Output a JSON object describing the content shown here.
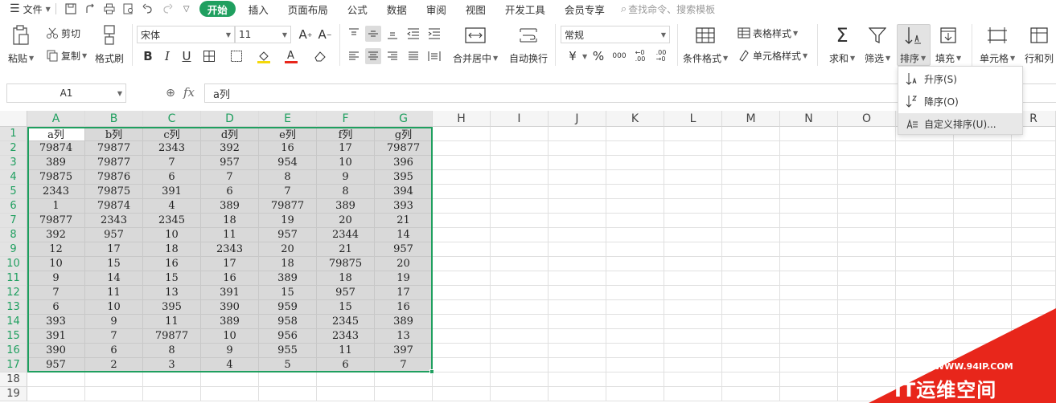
{
  "menubar": {
    "file_label": "文件",
    "tabs": [
      "开始",
      "插入",
      "页面布局",
      "公式",
      "数据",
      "审阅",
      "视图",
      "开发工具",
      "会员专享"
    ],
    "search_placeholder": "查找命令、搜索模板"
  },
  "ribbon": {
    "paste": "粘贴",
    "cut": "剪切",
    "copy": "复制",
    "format_painter": "格式刷",
    "font_name": "宋体",
    "font_size": "11",
    "merge_center": "合并居中",
    "wrap_text": "自动换行",
    "number_format": "常规",
    "conditional_format": "条件格式",
    "table_style": "表格样式",
    "cell_style": "单元格样式",
    "sum": "求和",
    "filter": "筛选",
    "sort": "排序",
    "fill": "填充",
    "cell": "单元格",
    "row_col": "行和列"
  },
  "sort_menu": {
    "items": [
      "升序(S)",
      "降序(O)",
      "自定义排序(U)..."
    ]
  },
  "formula_bar": {
    "name_box": "A1",
    "fx": "fx",
    "content": "a列"
  },
  "sheet": {
    "columns": [
      "A",
      "B",
      "C",
      "D",
      "E",
      "F",
      "G",
      "H",
      "I",
      "J",
      "K",
      "L",
      "M",
      "N",
      "O",
      "P",
      "Q",
      "R"
    ],
    "rows": [
      "1",
      "2",
      "3",
      "4",
      "5",
      "6",
      "7",
      "8",
      "9",
      "10",
      "11",
      "12",
      "13",
      "14",
      "15",
      "16",
      "17",
      "18",
      "19"
    ],
    "data": [
      [
        "a列",
        "b列",
        "c列",
        "d列",
        "e列",
        "f列",
        "g列"
      ],
      [
        "79874",
        "79877",
        "2343",
        "392",
        "16",
        "17",
        "79877"
      ],
      [
        "389",
        "79877",
        "7",
        "957",
        "954",
        "10",
        "396"
      ],
      [
        "79875",
        "79876",
        "6",
        "7",
        "8",
        "9",
        "395"
      ],
      [
        "2343",
        "79875",
        "391",
        "6",
        "7",
        "8",
        "394"
      ],
      [
        "1",
        "79874",
        "4",
        "389",
        "79877",
        "389",
        "393"
      ],
      [
        "79877",
        "2343",
        "2345",
        "18",
        "19",
        "20",
        "21"
      ],
      [
        "392",
        "957",
        "10",
        "11",
        "957",
        "2344",
        "14"
      ],
      [
        "12",
        "17",
        "18",
        "2343",
        "20",
        "21",
        "957"
      ],
      [
        "10",
        "15",
        "16",
        "17",
        "18",
        "79875",
        "20"
      ],
      [
        "9",
        "14",
        "15",
        "16",
        "389",
        "18",
        "19"
      ],
      [
        "7",
        "11",
        "13",
        "391",
        "15",
        "957",
        "17"
      ],
      [
        "6",
        "10",
        "395",
        "390",
        "959",
        "15",
        "16"
      ],
      [
        "393",
        "9",
        "11",
        "389",
        "958",
        "2345",
        "389"
      ],
      [
        "391",
        "7",
        "79877",
        "10",
        "956",
        "2343",
        "13"
      ],
      [
        "390",
        "6",
        "8",
        "9",
        "955",
        "11",
        "397"
      ],
      [
        "957",
        "2",
        "3",
        "4",
        "5",
        "6",
        "7"
      ]
    ]
  },
  "watermark": {
    "url": "WWW.94IP.COM",
    "text": "IT运维空间"
  },
  "colors": {
    "accent": "#1f9f5f",
    "selection_fill": "#d9d9d9",
    "watermark_red": "#e8261b"
  }
}
